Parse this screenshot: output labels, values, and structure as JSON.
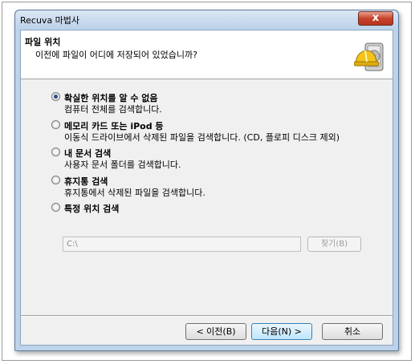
{
  "window": {
    "title": "Recuva 마법사",
    "close_symbol": "x"
  },
  "header": {
    "title": "파일 위치",
    "subtitle": "이전에 파일이 어디에 저장되어 있었습니까?",
    "logo_icon": "hardhat-drive-icon"
  },
  "options": [
    {
      "label": "확실한 위치를 알 수 없음",
      "description": "컴퓨터 전체를 검색합니다.",
      "selected": true
    },
    {
      "label": "메모리 카드 또는 iPod 등",
      "description": "이동식 드라이브에서 삭제된 파일을 검색합니다. (CD, 플로피 디스크 제외)",
      "selected": false
    },
    {
      "label": "내 문서 검색",
      "description": "사용자 문서 폴더를 검색합니다.",
      "selected": false
    },
    {
      "label": "휴지통 검색",
      "description": "휴지통에서 삭제된 파일을 검색합니다.",
      "selected": false
    },
    {
      "label": "특정 위치 검색",
      "description": "",
      "selected": false
    }
  ],
  "path_input": {
    "value": "C:\\"
  },
  "browse_button": {
    "label": "찾기(B)"
  },
  "buttons": {
    "back": "< 이전(B)",
    "next": "다음(N) >",
    "cancel": "취소"
  }
}
